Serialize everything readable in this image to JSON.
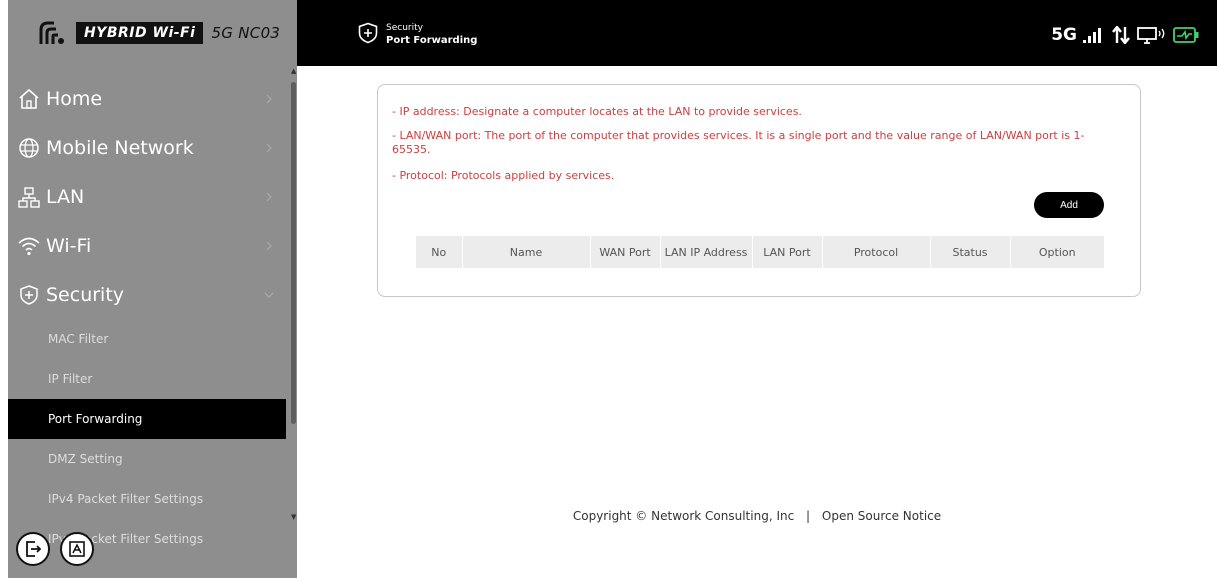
{
  "brand": {
    "badge": "HYBRID Wi-Fi",
    "model": "5G NC03"
  },
  "header": {
    "section": "Security",
    "page": "Port Forwarding",
    "network": "5G"
  },
  "sidebar": {
    "menu": [
      {
        "label": "Home",
        "icon": "home-icon",
        "expanded": false
      },
      {
        "label": "Mobile Network",
        "icon": "globe-icon",
        "expanded": false
      },
      {
        "label": "LAN",
        "icon": "lan-icon",
        "expanded": false
      },
      {
        "label": "Wi-Fi",
        "icon": "wifi-icon",
        "expanded": false
      },
      {
        "label": "Security",
        "icon": "shield-plus-icon",
        "expanded": true
      }
    ],
    "submenu": [
      {
        "label": "MAC Filter",
        "active": false
      },
      {
        "label": "IP Filter",
        "active": false
      },
      {
        "label": "Port Forwarding",
        "active": true
      },
      {
        "label": "DMZ Setting",
        "active": false
      },
      {
        "label": "IPv4 Packet Filter Settings",
        "active": false
      },
      {
        "label": "IPv6 Packet Filter Settings",
        "active": false
      }
    ]
  },
  "notes": [
    "- IP address: Designate a computer locates at the LAN to provide services.",
    "- LAN/WAN port: The port of the computer that provides services. It is a single port and the value range of LAN/WAN port is 1-65535.",
    "- Protocol: Protocols applied by services."
  ],
  "add_button": "Add",
  "table": {
    "columns": [
      "No",
      "Name",
      "WAN Port",
      "LAN IP Address",
      "LAN Port",
      "Protocol",
      "Status",
      "Option"
    ],
    "rows": []
  },
  "footer": {
    "copyright": "Copyright © Network Consulting, Inc",
    "separator": "|",
    "link": "Open Source Notice"
  },
  "colors": {
    "sidebar_bg": "#8e8e8e",
    "header_bg": "#000000",
    "note_text": "#d63b3b",
    "battery": "#3fd36a"
  }
}
